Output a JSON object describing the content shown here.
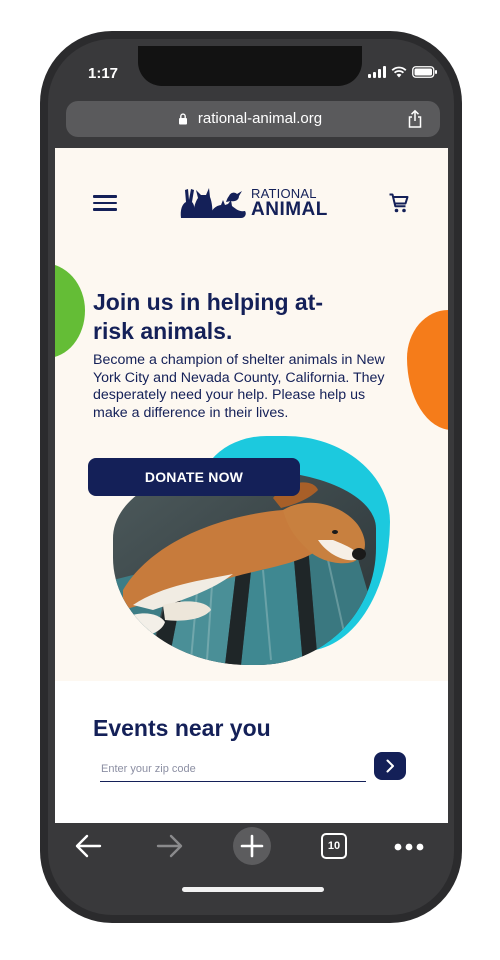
{
  "status": {
    "time": "1:17"
  },
  "browser": {
    "url": "rational-animal.org",
    "tab_count": "10"
  },
  "site": {
    "logo": {
      "line1": "RATIONAL",
      "line2": "ANIMAL"
    },
    "hero": {
      "headline": "Join us in helping at-risk animals.",
      "body": "Become a champion of shelter animals in New York City and Nevada County, California. They desperately need your help. Please help us make a difference in their lives.",
      "cta_label": "DONATE NOW"
    },
    "events": {
      "title": "Events near you",
      "zip_placeholder": "Enter your zip code"
    }
  },
  "icons": {
    "menu": "menu-icon",
    "cart": "cart-icon",
    "lock": "lock-icon",
    "share": "share-icon",
    "back": "back-arrow-icon",
    "forward": "forward-arrow-icon",
    "new_tab": "plus-icon",
    "more": "more-dots-icon",
    "go": "chevron-right-icon"
  },
  "colors": {
    "navy": "#142058",
    "teal": "#1cc9de",
    "green": "#64bd36",
    "orange": "#f57c1a",
    "cream": "#fdf8f1"
  }
}
